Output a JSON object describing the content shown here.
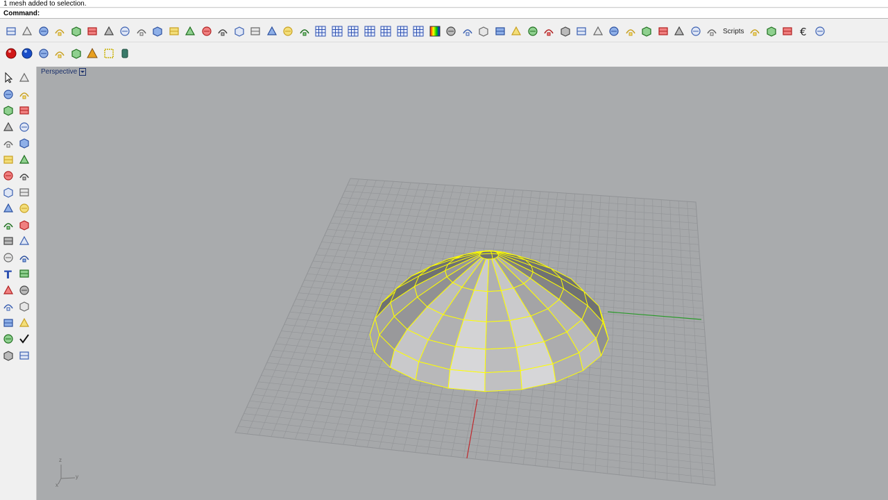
{
  "history": {
    "text": "1 mesh added to selection."
  },
  "command": {
    "label": "Command:",
    "value": ""
  },
  "toolbar1": {
    "scripts_label": "Scripts",
    "icons": [
      "select-all-icon",
      "undo-icon",
      "rebuild-icon",
      "zoom-icon",
      "fillet-icon",
      "cut-icon",
      "shell-icon",
      "extrude-icon",
      "boolean-icon",
      "twist-icon",
      "bend-icon",
      "flow-icon",
      "point-icon",
      "copy-icon",
      "move-icon",
      "curve-icon",
      "group-icon",
      "layout-icon",
      "mesh-icon",
      "grid-icon",
      "grid2-icon",
      "grid3-icon",
      "grid4-icon",
      "grid5-icon",
      "grid6-icon",
      "grid7-icon",
      "gradient-icon",
      "color-icon",
      "nurbs-icon",
      "patch-icon",
      "crease-icon",
      "weld-icon",
      "unweld-icon",
      "reduce-icon",
      "extract-icon",
      "checker-icon",
      "flip-icon",
      "blend-icon",
      "pin-icon",
      "bucket1-icon",
      "bucket2-icon",
      "bucket3-icon",
      "shield-icon",
      "shield2-icon"
    ],
    "tail_icons": [
      "plane-icon",
      "surface-icon",
      "render-icon",
      "euro-icon",
      "polygon-icon"
    ]
  },
  "toolbar2": {
    "icons": [
      "red-sphere-icon",
      "blue-sphere-icon",
      "box-icon",
      "cube-icon",
      "shaded-icon",
      "cone-icon",
      "frame-icon",
      "cylinder-icon"
    ]
  },
  "sidebar": {
    "items": [
      "select-arrow-icon",
      "point-icon",
      "line-icon",
      "polyline-icon",
      "circle-icon",
      "ellipse-icon",
      "polygon-icon",
      "rectangle-icon",
      "arc-icon",
      "curve-icon",
      "surface-icon",
      "loft-icon",
      "box-icon",
      "sphere-icon",
      "solid-icon",
      "planar-icon",
      "explode-icon",
      "join-icon",
      "trim-icon",
      "split-icon",
      "group-icon",
      "ungroup-icon",
      "fillet-icon",
      "chamfer-icon",
      "text-icon",
      "dimension-icon",
      "transform-icon",
      "scale-icon",
      "mesh-box-icon",
      "mesh-grid-icon",
      "array-icon",
      "align-icon",
      "analyze-icon",
      "check-icon",
      "render-icon",
      "material-icon"
    ]
  },
  "viewport": {
    "title": "Perspective",
    "axis": {
      "z": "z",
      "y": "y",
      "x": "x"
    },
    "colors": {
      "background": "#a9abad",
      "grid": "#929497",
      "selection": "#ffff00",
      "x_axis": "#c0282d",
      "y_axis": "#2a9a2a"
    }
  }
}
